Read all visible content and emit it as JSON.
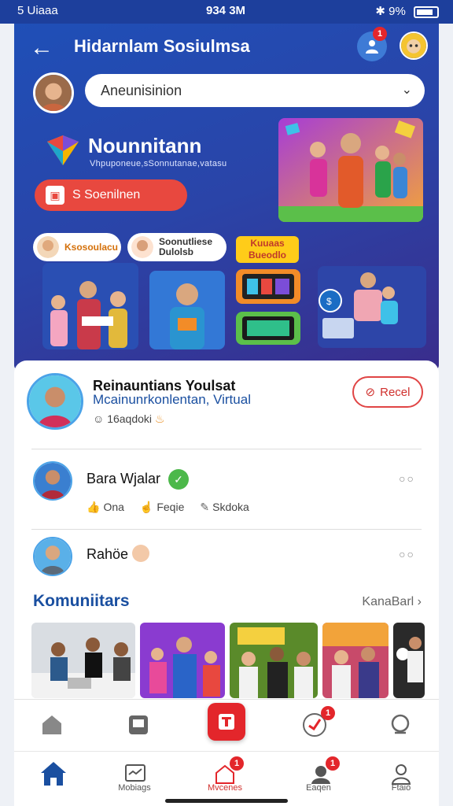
{
  "status_bar": {
    "carrier": "5 Uiaaa",
    "time": "934 3M",
    "battery": "9%"
  },
  "header": {
    "title": "Hidarnlam Sosiulmsa",
    "notification_count": "1"
  },
  "location_select": {
    "value": "Aneunisinion"
  },
  "brand": {
    "name": "Nounnitann",
    "tagline": "Vhpuponeue,sSonnutanae,vatasu"
  },
  "cta": {
    "label": "S Soenilnen"
  },
  "hero_pills": [
    {
      "label": "Ksosoulacu"
    },
    {
      "label": "Soonutliese Dulolsb"
    }
  ],
  "hero_tag": {
    "label": "Kuuaas Bueodlo"
  },
  "featured": {
    "name": "Reinauntians Youlsat",
    "subtitle": "Mcainunrkonlentan, Virtual",
    "meta": "16aqdoki",
    "button": "Recel"
  },
  "posts": [
    {
      "name": "Bara Wjalar",
      "actions": [
        "Ona",
        "Feqie",
        "Skdoka"
      ]
    },
    {
      "name": "Rahöe"
    }
  ],
  "section": {
    "title": "Komuniitars",
    "link": "KanaBarl"
  },
  "nav": {
    "top_badge": "1",
    "items": [
      {
        "label": "Mobiags"
      },
      {
        "label": "Mvcenes",
        "badge": "1"
      },
      {
        "label": "Eaqen",
        "badge": "1"
      },
      {
        "label": "Ftaio"
      }
    ]
  },
  "colors": {
    "primary": "#1f4fb7",
    "accent": "#e8483f",
    "link": "#1a4fa0",
    "badge": "#e3262b"
  }
}
